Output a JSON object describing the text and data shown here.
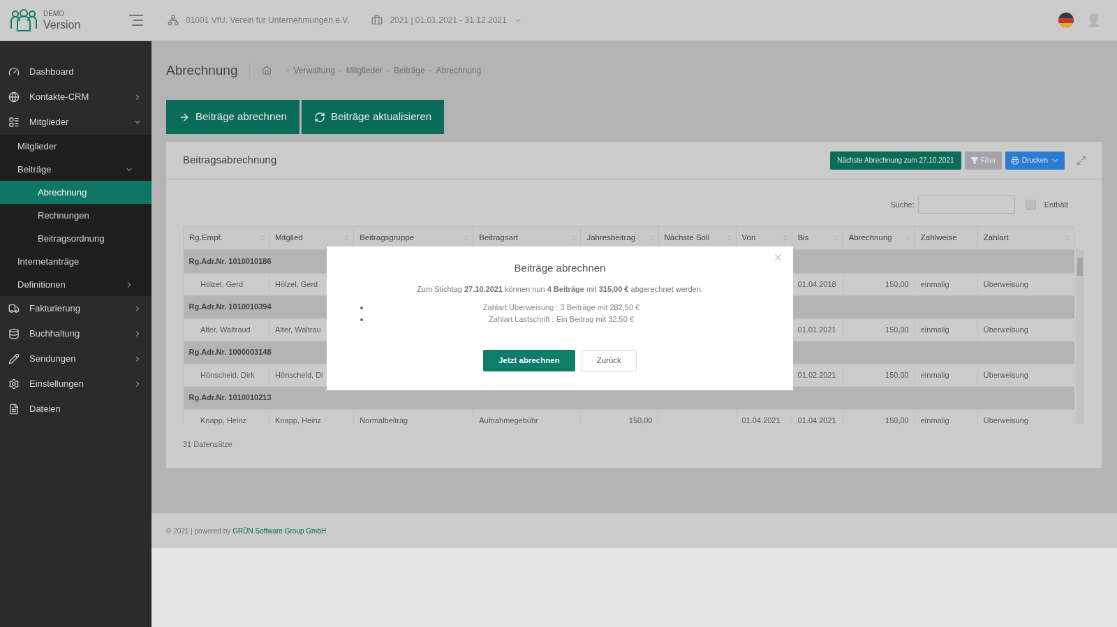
{
  "header": {
    "logo_small": "DEMO",
    "logo_large": "Version",
    "organization": "01001 VfU. Verein für Unternehmungen e.V.",
    "period": "2021 | 01.01.2021 - 31.12.2021"
  },
  "sidebar": {
    "items": [
      {
        "label": "Dashboard",
        "kind": "link"
      },
      {
        "label": "Kontakte-CRM",
        "kind": "menu",
        "expanded": false
      },
      {
        "label": "Mitglieder",
        "kind": "menu",
        "expanded": true,
        "children": [
          {
            "label": "Mitglieder",
            "kind": "link"
          },
          {
            "label": "Beiträge",
            "kind": "menu",
            "expanded": true,
            "children": [
              {
                "label": "Abrechnung",
                "selected": true
              },
              {
                "label": "Rechnungen",
                "selected": false
              },
              {
                "label": "Beitragsordnung",
                "selected": false
              }
            ]
          },
          {
            "label": "Internetanträge",
            "kind": "link"
          },
          {
            "label": "Definitionen",
            "kind": "menu",
            "expanded": false
          }
        ]
      },
      {
        "label": "Fakturierung",
        "kind": "menu",
        "expanded": false
      },
      {
        "label": "Buchhaltung",
        "kind": "menu",
        "expanded": false
      },
      {
        "label": "Sendungen",
        "kind": "menu",
        "expanded": false
      },
      {
        "label": "Einstellungen",
        "kind": "menu",
        "expanded": false
      },
      {
        "label": "Dateien",
        "kind": "link"
      }
    ]
  },
  "page": {
    "title": "Abrechnung",
    "breadcrumb": {
      "separator": "-",
      "items": [
        "Verwaltung",
        "Mitglieder",
        "Beiträge",
        "Abrechnung"
      ]
    }
  },
  "actions": [
    {
      "label": "Beiträge abrechnen"
    },
    {
      "label": "Beiträge aktualisieren"
    }
  ],
  "card": {
    "title": "Beitragsabrechnung",
    "next_billing": "Nächste Abrechnung zum 27.10.2021",
    "filter": {
      "label": "Filter",
      "disabled": true
    },
    "print": "Drucken",
    "search": {
      "label": "Suche:"
    },
    "contains": {
      "label": "Enthält",
      "checked": false
    },
    "table": {
      "columns": [
        {
          "label": "Rg.Empf.",
          "sortable": true
        },
        {
          "label": "Mitglied",
          "sortable": true
        },
        {
          "label": "Beitragsgruppe",
          "sortable": true
        },
        {
          "label": "Beitragsart",
          "sortable": true
        },
        {
          "label": "Jahresbeitrag",
          "sortable": true
        },
        {
          "label": "Nächste Soll",
          "sortable": true
        },
        {
          "label": "Von",
          "sortable": true
        },
        {
          "label": "Bis",
          "sortable": true
        },
        {
          "label": "Abrechnung",
          "sortable": true
        },
        {
          "label": "Zahlweise",
          "sortable": false
        },
        {
          "label": "Zahlart",
          "sortable": true
        }
      ],
      "groups": [
        {
          "label": "Rg.Adr.Nr. 1010010186",
          "rows": [
            [
              "Hölzel, Gerd",
              "Hölzel, Gerd",
              null,
              null,
              null,
              null,
              null,
              "01.04.2018",
              "150,00",
              "einmalig",
              "Überweisung"
            ]
          ]
        },
        {
          "label": "Rg.Adr.Nr. 1010010394",
          "rows": [
            [
              "Alter, Waltraud",
              "Alter, Waltrau",
              null,
              null,
              null,
              null,
              null,
              "01.01.2021",
              "150,00",
              "einmalig",
              "Überweisung"
            ]
          ]
        },
        {
          "label": "Rg.Adr.Nr. 1000003148",
          "rows": [
            [
              "Hönscheid, Dirk",
              "Hönscheid, Di",
              null,
              null,
              null,
              null,
              null,
              "01.02.2021",
              "150,00",
              "einmalig",
              "Überweisung"
            ]
          ]
        },
        {
          "label": "Rg.Adr.Nr. 1010010213",
          "rows": [
            [
              "Knapp, Heinz",
              "Knapp, Heinz",
              "Normalbeitrag",
              "Aufnahmegebühr",
              "150,00",
              null,
              "01.04.2021",
              "01.04.2021",
              "150,00",
              "einmalig",
              "Überweisung"
            ]
          ]
        }
      ]
    },
    "record_count": "31 Datensätze"
  },
  "footer": {
    "text": "© 2021 | powered by",
    "link": "GRÜN Software Group GmbH"
  },
  "modal": {
    "title": "Beiträge abrechnen",
    "message": "Zum Stichtag **27.10.2021** können nun **4 Beiträge** mit **315,00 €** abgerechnet werden.",
    "bullets": [
      "Zahlart Überweisung : 3 Beiträge mit 282,50 €",
      "Zahlart Lastschrift : Ein Beitrag mit 32,50 €"
    ],
    "confirm": "Jetzt abrechnen",
    "cancel": "Zurück"
  }
}
